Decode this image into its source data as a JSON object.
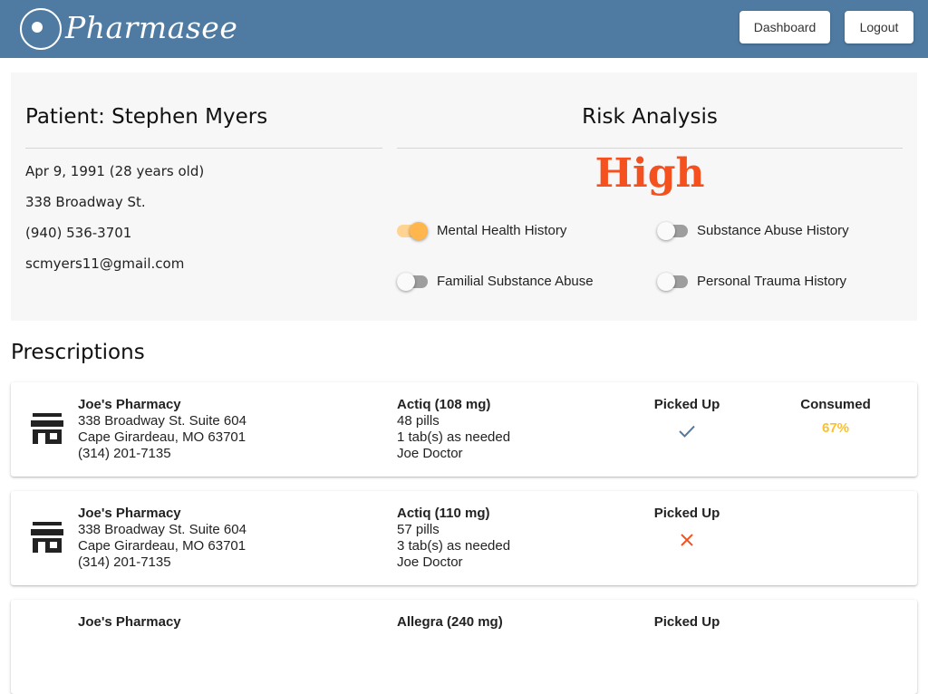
{
  "app": {
    "brand": "Pharmasee",
    "nav": {
      "dashboard_label": "Dashboard",
      "logout_label": "Logout"
    }
  },
  "patient": {
    "title": "Patient: Stephen Myers",
    "dob": "Apr 9, 1991 (28 years old)",
    "address": "338 Broadway St.",
    "phone": "(940) 536-3701",
    "email": "scmyers11@gmail.com"
  },
  "risk": {
    "title": "Risk Analysis",
    "level": "High",
    "level_color": "#f4511e",
    "factors": [
      {
        "label": "Mental Health History",
        "enabled": true
      },
      {
        "label": "Substance Abuse History",
        "enabled": false
      },
      {
        "label": "Familial Substance Abuse",
        "enabled": false
      },
      {
        "label": "Personal Trauma History",
        "enabled": false
      }
    ]
  },
  "prescriptions": {
    "title": "Prescriptions",
    "picked_up_label": "Picked Up",
    "consumed_label": "Consumed",
    "items": [
      {
        "pharmacy_name": "Joe's Pharmacy",
        "pharmacy_street": "338 Broadway St. Suite 604",
        "pharmacy_city": "Cape Girardeau, MO 63701",
        "pharmacy_phone": "(314) 201-7135",
        "drug": "Actiq (108 mg)",
        "quantity": "48 pills",
        "dosage": "1 tab(s) as needed",
        "doctor": "Joe Doctor",
        "picked_up": true,
        "status_icon": "check-icon",
        "consumed": "67%"
      },
      {
        "pharmacy_name": "Joe's Pharmacy",
        "pharmacy_street": "338 Broadway St. Suite 604",
        "pharmacy_city": "Cape Girardeau, MO 63701",
        "pharmacy_phone": "(314) 201-7135",
        "drug": "Actiq (110 mg)",
        "quantity": "57 pills",
        "dosage": "3 tab(s) as needed",
        "doctor": "Joe Doctor",
        "picked_up": false,
        "status_icon": "close-icon"
      },
      {
        "pharmacy_name": "Joe's Pharmacy",
        "drug": "Allegra (240 mg)"
      }
    ]
  },
  "colors": {
    "header": "#4f7ba3",
    "panel": "#f7f7f7",
    "toggle_on": "#ffb74d",
    "check": "#4f7ba3",
    "cross": "#f4511e",
    "consumed": "#fbc02d"
  }
}
